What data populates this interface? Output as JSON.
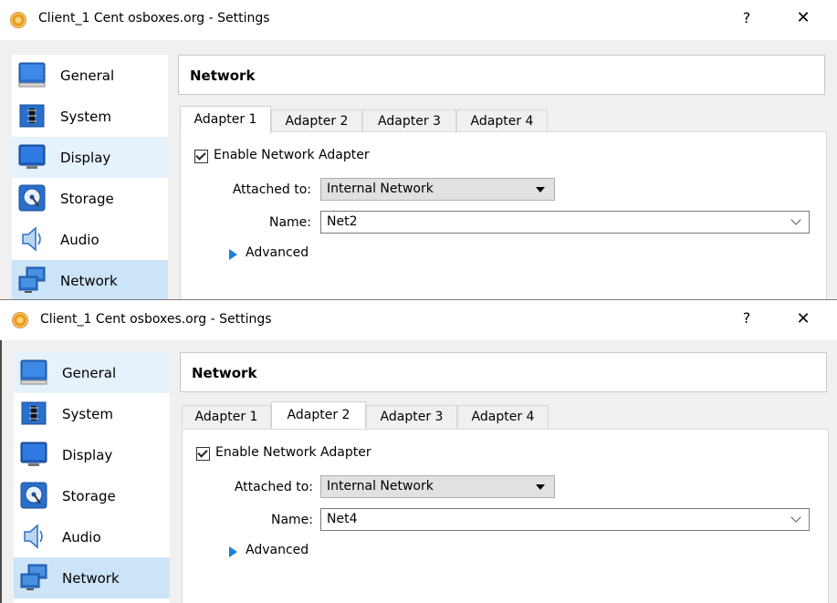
{
  "windows": [
    {
      "title": "Client_1 Cent osboxes.org - Settings",
      "help_glyph": "?",
      "close_glyph": "✕",
      "sidebar": [
        {
          "label": "General",
          "icon": "general-icon"
        },
        {
          "label": "System",
          "icon": "system-icon"
        },
        {
          "label": "Display",
          "icon": "display-icon"
        },
        {
          "label": "Storage",
          "icon": "storage-icon"
        },
        {
          "label": "Audio",
          "icon": "audio-icon"
        },
        {
          "label": "Network",
          "icon": "network-icon"
        }
      ],
      "section_title": "Network",
      "tabs": [
        "Adapter 1",
        "Adapter 2",
        "Adapter 3",
        "Adapter 4"
      ],
      "active_tab": "Adapter 1",
      "enable_label": "Enable Network Adapter",
      "enable_checked": true,
      "attached_label": "Attached to:",
      "attached_value": "Internal Network",
      "name_label": "Name:",
      "name_value": "Net2",
      "advanced_label": "Advanced"
    },
    {
      "title": "Client_1 Cent osboxes.org - Settings",
      "help_glyph": "?",
      "close_glyph": "✕",
      "sidebar": [
        {
          "label": "General",
          "icon": "general-icon"
        },
        {
          "label": "System",
          "icon": "system-icon"
        },
        {
          "label": "Display",
          "icon": "display-icon"
        },
        {
          "label": "Storage",
          "icon": "storage-icon"
        },
        {
          "label": "Audio",
          "icon": "audio-icon"
        },
        {
          "label": "Network",
          "icon": "network-icon"
        }
      ],
      "section_title": "Network",
      "tabs": [
        "Adapter 1",
        "Adapter 2",
        "Adapter 3",
        "Adapter 4"
      ],
      "active_tab": "Adapter 2",
      "enable_label": "Enable Network Adapter",
      "enable_checked": true,
      "attached_label": "Attached to:",
      "attached_value": "Internal Network",
      "name_label": "Name:",
      "name_value": "Net4",
      "advanced_label": "Advanced"
    }
  ],
  "colors": {
    "selection_light": "#e5f1fb",
    "selection_dark": "#cce4f7",
    "accent_blue": "#1f7fd6"
  }
}
